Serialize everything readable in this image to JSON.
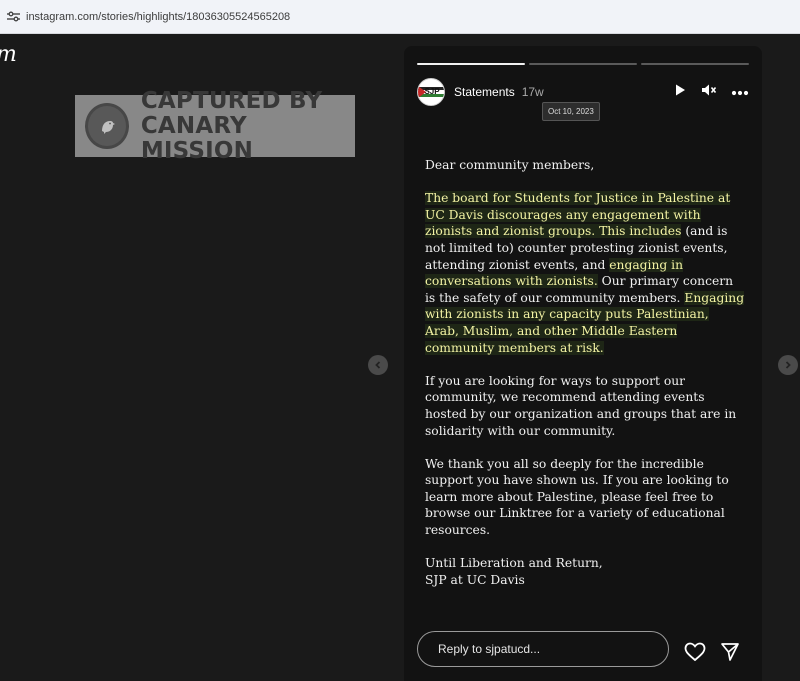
{
  "browser": {
    "url": "instagram.com/stories/highlights/18036305524565208"
  },
  "instagram": {
    "logo_fragment": "m"
  },
  "watermark": {
    "line1": "CAPTURED BY",
    "line2": "CANARY MISSION"
  },
  "story": {
    "progress": [
      1.0,
      0.0,
      0.0
    ],
    "username": "Statements",
    "time_ago": "17w",
    "date_tooltip": "Oct 10, 2023",
    "avatar_text": "SJP",
    "reply_placeholder": "Reply to sjpatucd...",
    "letter": {
      "greeting": "Dear community members,",
      "p1_a": "The board for Students for Justice in Palestine at UC Davis discourages any engagement with zionists and zionist groups. This includes",
      "p1_b": " (and is not limited to) counter protesting zionist events, attending zionist events, and ",
      "p1_c": "engaging in conversations with zionists.",
      "p1_d": " Our primary concern is the safety of our community members. ",
      "p1_e": "Engaging with zionists in any capacity puts Palestinian, Arab, Muslim, and other Middle Eastern community members at risk.",
      "p2": "If you are looking for ways to support our community, we recommend attending events hosted by our organization and groups that are in solidarity with our community.",
      "p3": "We thank you all so deeply for the incredible support you have shown us. If you are looking to learn more about Palestine, please feel free to browse our Linktree for a variety of educational resources.",
      "closing": "Until Liberation and Return,",
      "signature": "SJP at UC Davis"
    }
  },
  "icons": {
    "site": "site-settings-icon",
    "play": "play-icon",
    "mute": "muted-speaker-icon",
    "more": "more-options-icon",
    "prev": "chevron-left-icon",
    "next": "chevron-right-icon",
    "like": "heart-icon",
    "share": "send-icon"
  }
}
